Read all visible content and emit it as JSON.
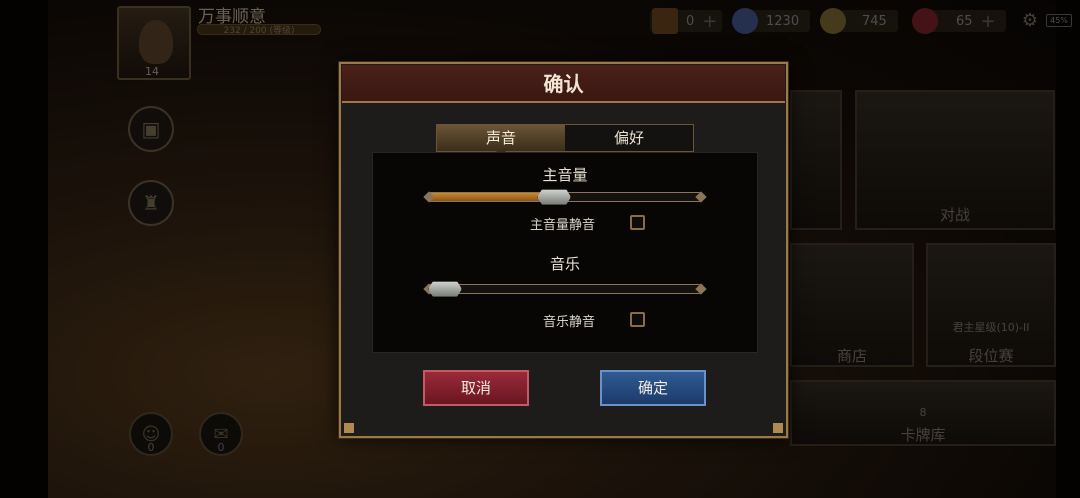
{
  "player": {
    "name": "万事顺意",
    "exp_text": "232 / 200 (等级)",
    "level": "14"
  },
  "resources": [
    {
      "icon": "card-pack-icon",
      "value": "0"
    },
    {
      "icon": "crystal-icon",
      "value": "1230"
    },
    {
      "icon": "coin-icon",
      "value": "745"
    },
    {
      "icon": "gem-icon",
      "value": "65"
    }
  ],
  "battery": "45%",
  "tiles": {
    "battle": "对战",
    "shop": "商店",
    "ranked": "段位赛",
    "ranked_sub": "君主星级(10)-II",
    "deck": "卡牌库",
    "deck_count": "8"
  },
  "counts": {
    "friends": "0",
    "mail": "0"
  },
  "dialog": {
    "title": "确认",
    "tabs": [
      {
        "label": "声音",
        "active": true
      },
      {
        "label": "偏好",
        "active": false
      }
    ],
    "master_volume": {
      "label": "主音量",
      "value": 0.46,
      "mute_label": "主音量静音",
      "muted": false
    },
    "music": {
      "label": "音乐",
      "value": 0.04,
      "mute_label": "音乐静音",
      "muted": false
    },
    "cancel_label": "取消",
    "ok_label": "确定"
  },
  "colors": {
    "title_bar": "#4a201a",
    "frame_gold": "#9c7a45",
    "slider_fill": "#c98a2a",
    "cancel_red": "#9a2a38",
    "ok_blue": "#2f5a92"
  }
}
